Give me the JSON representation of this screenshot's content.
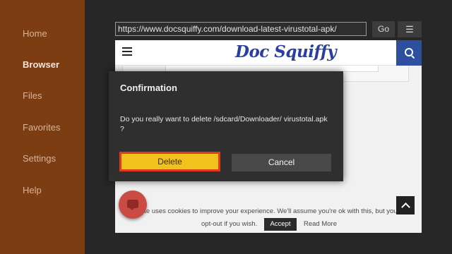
{
  "sidebar": {
    "items": [
      {
        "label": "Home"
      },
      {
        "label": "Browser",
        "active": true
      },
      {
        "label": "Files"
      },
      {
        "label": "Favorites"
      },
      {
        "label": "Settings"
      },
      {
        "label": "Help"
      }
    ]
  },
  "toolbar": {
    "url": "https://www.docsquiffy.com/download-latest-virustotal-apk/",
    "go_label": "Go",
    "menu_icon": "menu-icon"
  },
  "site": {
    "logo": "Doc Squiffy",
    "menu_icon": "hamburger-icon",
    "search_icon": "search-icon"
  },
  "cookie": {
    "text": "site uses cookies to improve your experience. We'll assume you're ok with this, but you",
    "optout": "opt-out if you wish.",
    "accept_label": "Accept",
    "readmore_label": "Read More"
  },
  "dialog": {
    "title": "Confirmation",
    "message": "Do you really want to delete /sdcard/Downloader/ virustotal.apk ?",
    "delete_label": "Delete",
    "cancel_label": "Cancel"
  },
  "colors": {
    "sidebar": "#7d3d12",
    "delete_button": "#f1c21e",
    "focus_border": "#e23a1c",
    "logo": "#2a3f9e",
    "search_button": "#2d4f9d"
  }
}
